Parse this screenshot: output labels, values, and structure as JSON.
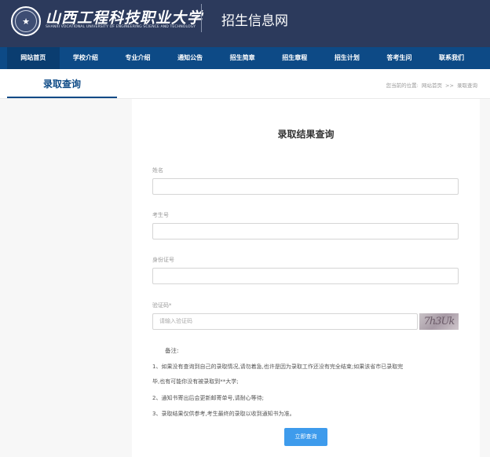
{
  "header": {
    "logo_cn": "山西工程科技职业大学",
    "logo_en": "SHANXI VOCATIONAL UNIVERSITY OF ENGINEERING SCIENCE AND TECHNOLOGY",
    "site_title": "招生信息网"
  },
  "nav": {
    "items": [
      {
        "label": "网站首页"
      },
      {
        "label": "学校介绍"
      },
      {
        "label": "专业介绍"
      },
      {
        "label": "通知公告"
      },
      {
        "label": "招生简章"
      },
      {
        "label": "招生章程"
      },
      {
        "label": "招生计划"
      },
      {
        "label": "答考生问"
      },
      {
        "label": "联系我们"
      }
    ]
  },
  "subbar": {
    "title": "录取查询",
    "breadcrumb_prefix": "您当前的位置:",
    "breadcrumb_home": "网站首页",
    "breadcrumb_sep": ">>",
    "breadcrumb_current": "录取查询"
  },
  "form": {
    "title": "录取结果查询",
    "name_label": "姓名",
    "exam_no_label": "考生号",
    "id_label": "身份证号",
    "captcha_label": "验证码*",
    "captcha_placeholder": "请输入验证码",
    "captcha_text": "7h3Uk",
    "submit_label": "立即查询"
  },
  "notes": {
    "title": "备注:",
    "line1a": "1、如果没有查询到自己的录取情况,请勿着急,也许是因为录取工作还没有完全结束;如果该省市已录取完",
    "line1b": "毕,也有可能你没有被录取到**大学;",
    "line2": "2、通知书寄出后会更新邮寄单号,请耐心等待;",
    "line3": "3、录取结果仅供参考,考生最终的录取以收到通知书为准。"
  },
  "colors": {
    "header_bg": "#2c3a5c",
    "nav_bg": "#0d4a86",
    "accent": "#0d4a86",
    "button": "#3e9bec"
  }
}
